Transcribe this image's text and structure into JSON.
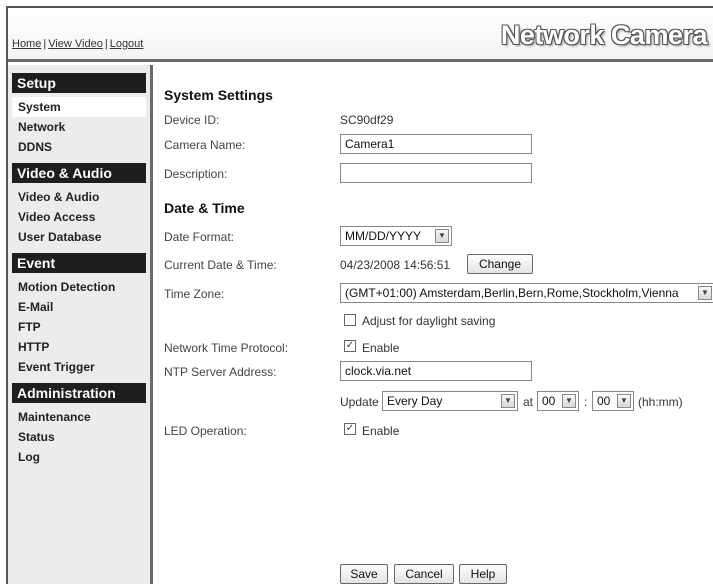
{
  "header": {
    "links": [
      "Home",
      "View Video",
      "Logout"
    ],
    "brand": "Network Camera"
  },
  "sidebar": {
    "sections": [
      {
        "title": "Setup",
        "items": [
          "System",
          "Network",
          "DDNS"
        ]
      },
      {
        "title": "Video & Audio",
        "items": [
          "Video & Audio",
          "Video Access",
          "User Database"
        ]
      },
      {
        "title": "Event",
        "items": [
          "Motion Detection",
          "E-Mail",
          "FTP",
          "HTTP",
          "Event Trigger"
        ]
      },
      {
        "title": "Administration",
        "items": [
          "Maintenance",
          "Status",
          "Log"
        ]
      }
    ],
    "active_item": "System"
  },
  "system": {
    "heading": "System Settings",
    "device_id_label": "Device ID:",
    "device_id_value": "SC90df29",
    "camera_name_label": "Camera Name:",
    "camera_name_value": "Camera1",
    "description_label": "Description:",
    "description_value": ""
  },
  "datetime": {
    "heading": "Date & Time",
    "date_format_label": "Date Format:",
    "date_format_value": "MM/DD/YYYY",
    "current_label": "Current Date & Time:",
    "current_value": "04/23/2008  14:56:51",
    "change_button": "Change",
    "timezone_label": "Time Zone:",
    "timezone_value": "(GMT+01:00) Amsterdam,Berlin,Bern,Rome,Stockholm,Vienna",
    "dst_label": "Adjust for daylight saving",
    "dst_checked": false,
    "ntp_label": "Network Time Protocol:",
    "ntp_enable_label": "Enable",
    "ntp_checked": true,
    "ntp_server_label": "NTP Server Address:",
    "ntp_server_value": "clock.via.net",
    "update_label": "Update",
    "update_freq_value": "Every Day",
    "at_label": "at",
    "hour_value": "00",
    "colon": ":",
    "minute_value": "00",
    "hhmm_label": "(hh:mm)"
  },
  "led": {
    "label": "LED Operation:",
    "enable_label": "Enable",
    "checked": true
  },
  "footer": {
    "save": "Save",
    "cancel": "Cancel",
    "help": "Help"
  }
}
